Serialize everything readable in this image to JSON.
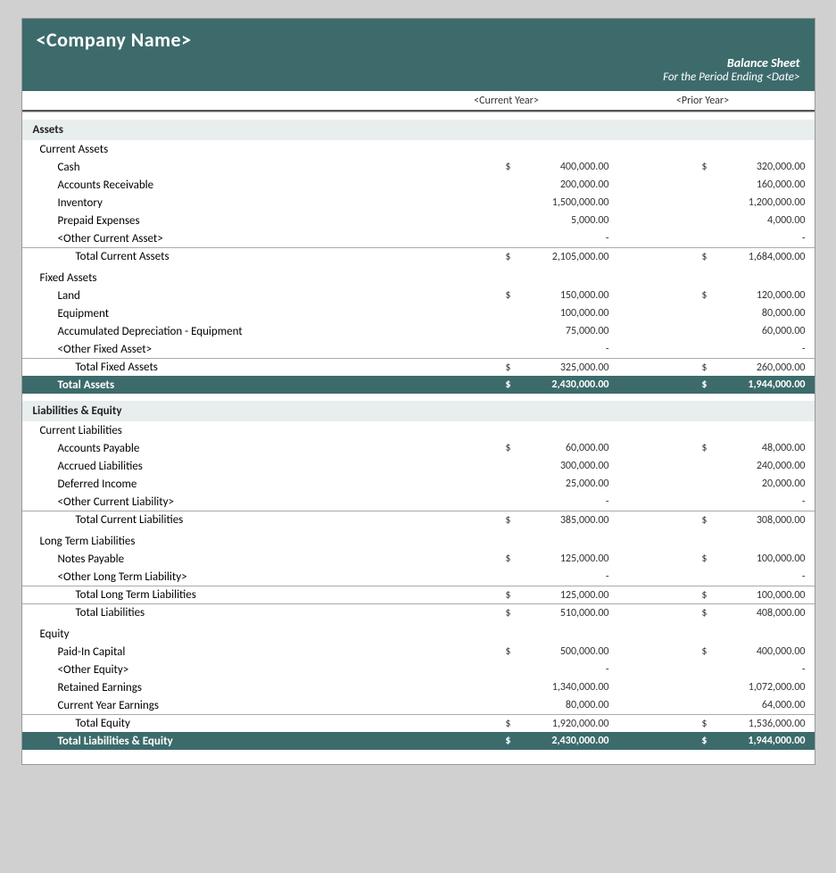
{
  "header": {
    "company_name": "<Company Name>",
    "report_title": "Balance Sheet",
    "report_subtitle": "For the Period Ending <Date>"
  },
  "columns": {
    "current_year": "<Current Year>",
    "prior_year": "<Prior Year>"
  },
  "sections": {
    "assets": {
      "label": "Assets",
      "current_assets": {
        "label": "Current Assets",
        "items": [
          {
            "name": "Cash",
            "cy_dollar": "$",
            "cy": "400,000.00",
            "py_dollar": "$",
            "py": "320,000.00"
          },
          {
            "name": "Accounts Receivable",
            "cy_dollar": "",
            "cy": "200,000.00",
            "py_dollar": "",
            "py": "160,000.00"
          },
          {
            "name": "Inventory",
            "cy_dollar": "",
            "cy": "1,500,000.00",
            "py_dollar": "",
            "py": "1,200,000.00"
          },
          {
            "name": "Prepaid Expenses",
            "cy_dollar": "",
            "cy": "5,000.00",
            "py_dollar": "",
            "py": "4,000.00"
          },
          {
            "name": "<Other Current Asset>",
            "cy_dollar": "",
            "cy": "-",
            "py_dollar": "",
            "py": "-"
          }
        ],
        "total": {
          "label": "Total Current Assets",
          "cy_dollar": "$",
          "cy": "2,105,000.00",
          "py_dollar": "$",
          "py": "1,684,000.00"
        }
      },
      "fixed_assets": {
        "label": "Fixed Assets",
        "items": [
          {
            "name": "Land",
            "cy_dollar": "$",
            "cy": "150,000.00",
            "py_dollar": "$",
            "py": "120,000.00"
          },
          {
            "name": "Equipment",
            "cy_dollar": "",
            "cy": "100,000.00",
            "py_dollar": "",
            "py": "80,000.00"
          },
          {
            "name": "Accumulated Depreciation - Equipment",
            "cy_dollar": "",
            "cy": "75,000.00",
            "py_dollar": "",
            "py": "60,000.00"
          },
          {
            "name": "<Other Fixed Asset>",
            "cy_dollar": "",
            "cy": "-",
            "py_dollar": "",
            "py": "-"
          }
        ],
        "total": {
          "label": "Total Fixed Assets",
          "cy_dollar": "$",
          "cy": "325,000.00",
          "py_dollar": "$",
          "py": "260,000.00"
        }
      },
      "total": {
        "label": "Total Assets",
        "cy_dollar": "$",
        "cy": "2,430,000.00",
        "py_dollar": "$",
        "py": "1,944,000.00"
      }
    },
    "liabilities_equity": {
      "label": "Liabilities & Equity",
      "current_liabilities": {
        "label": "Current Liabilities",
        "items": [
          {
            "name": "Accounts Payable",
            "cy_dollar": "$",
            "cy": "60,000.00",
            "py_dollar": "$",
            "py": "48,000.00"
          },
          {
            "name": "Accrued Liabilities",
            "cy_dollar": "",
            "cy": "300,000.00",
            "py_dollar": "",
            "py": "240,000.00"
          },
          {
            "name": "Deferred Income",
            "cy_dollar": "",
            "cy": "25,000.00",
            "py_dollar": "",
            "py": "20,000.00"
          },
          {
            "name": "<Other Current Liability>",
            "cy_dollar": "",
            "cy": "-",
            "py_dollar": "",
            "py": "-"
          }
        ],
        "total": {
          "label": "Total Current Liabilities",
          "cy_dollar": "$",
          "cy": "385,000.00",
          "py_dollar": "$",
          "py": "308,000.00"
        }
      },
      "long_term_liabilities": {
        "label": "Long Term Liabilities",
        "items": [
          {
            "name": "Notes Payable",
            "cy_dollar": "$",
            "cy": "125,000.00",
            "py_dollar": "$",
            "py": "100,000.00"
          },
          {
            "name": "<Other Long Term Liability>",
            "cy_dollar": "",
            "cy": "-",
            "py_dollar": "",
            "py": "-"
          }
        ],
        "total_long_term": {
          "label": "Total Long Term Liabilities",
          "cy_dollar": "$",
          "cy": "125,000.00",
          "py_dollar": "$",
          "py": "100,000.00"
        },
        "total_liabilities": {
          "label": "Total Liabilities",
          "cy_dollar": "$",
          "cy": "510,000.00",
          "py_dollar": "$",
          "py": "408,000.00"
        }
      },
      "equity": {
        "label": "Equity",
        "items": [
          {
            "name": "Paid-In Capital",
            "cy_dollar": "$",
            "cy": "500,000.00",
            "py_dollar": "$",
            "py": "400,000.00"
          },
          {
            "name": "<Other Equity>",
            "cy_dollar": "",
            "cy": "-",
            "py_dollar": "",
            "py": "-"
          },
          {
            "name": "Retained Earnings",
            "cy_dollar": "",
            "cy": "1,340,000.00",
            "py_dollar": "",
            "py": "1,072,000.00"
          },
          {
            "name": "Current Year Earnings",
            "cy_dollar": "",
            "cy": "80,000.00",
            "py_dollar": "",
            "py": "64,000.00"
          }
        ],
        "total": {
          "label": "Total Equity",
          "cy_dollar": "$",
          "cy": "1,920,000.00",
          "py_dollar": "$",
          "py": "1,536,000.00"
        }
      },
      "total": {
        "label": "Total Liabilities & Equity",
        "cy_dollar": "$",
        "cy": "2,430,000.00",
        "py_dollar": "$",
        "py": "1,944,000.00"
      }
    }
  }
}
